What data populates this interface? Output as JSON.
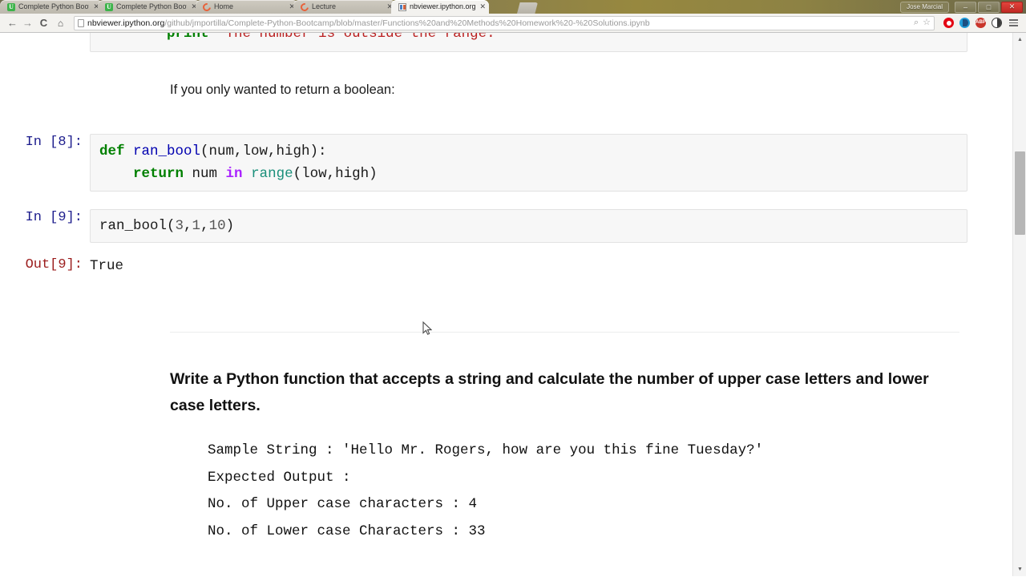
{
  "window": {
    "user_label": "Jose Marcial",
    "minimize_label": "–",
    "maximize_label": "□",
    "close_label": "✕"
  },
  "tabs": [
    {
      "title": "Complete Python Bootcar",
      "favicon": "udemy-icon",
      "close_label": "✕",
      "active": false
    },
    {
      "title": "Complete Python Bootcar",
      "favicon": "udemy-icon",
      "close_label": "✕",
      "active": false
    },
    {
      "title": "Home",
      "favicon": "jupyter-icon",
      "close_label": "✕",
      "active": false
    },
    {
      "title": "Lecture",
      "favicon": "jupyter-icon",
      "close_label": "✕",
      "active": false
    },
    {
      "title": "nbviewer.ipython.org/gith",
      "favicon": "nbviewer-icon",
      "close_label": "✕",
      "active": true
    }
  ],
  "toolbar": {
    "back_label": "←",
    "forward_label": "→",
    "reload_label": "C",
    "home_label": "⌂",
    "url_host": "nbviewer.ipython.org",
    "url_path": "/github/jmportilla/Complete-Python-Bootcamp/blob/master/Functions%20and%20Methods%20Homework%20-%20Solutions.ipynb",
    "url_full": "nbviewer.ipython.org/github/jmportilla/Complete-Python-Bootcamp/blob/master/Functions%20and%20Methods%20Homework%20-%20Solutions.ipynb",
    "search_icon_label": "⌕",
    "bookmark_icon_label": "☆",
    "ext_abp_label": "ABP"
  },
  "notebook": {
    "top_cell": {
      "indent": "        ",
      "keyword": "print",
      "space": " ",
      "string": "\"The number is outside the range.\""
    },
    "markdown_intro": "If you only wanted to return a boolean:",
    "cell_in8": {
      "prompt": "In [8]:",
      "line1_def": "def",
      "line1_name": " ran_bool",
      "line1_args": "(num,low,high):",
      "line2_indent": "    ",
      "line2_return": "return",
      "line2_mid": " num ",
      "line2_in": "in",
      "line2_range": " range",
      "line2_args": "(low,high)"
    },
    "cell_in9": {
      "prompt": "In [9]:",
      "call_name": "ran_bool(",
      "arg1": "3",
      "comma1": ",",
      "arg2": "1",
      "comma2": ",",
      "arg3": "10",
      "close": ")"
    },
    "cell_out9": {
      "prompt": "Out[9]:",
      "value": "True"
    },
    "question_heading": "Write a Python function that accepts a string and calculate the number of upper case letters and lower case letters.",
    "sample_block": {
      "line1": "Sample String : 'Hello Mr. Rogers, how are you this fine Tuesday?'",
      "line2": "Expected Output :",
      "line3": "No. of Upper case characters : 4",
      "line4": "No. of Lower case Characters : 33"
    }
  },
  "scrollbar": {
    "up_arrow": "▲",
    "down_arrow": "▼"
  },
  "colors": {
    "keyword_green": "#008000",
    "string_red": "#ba2121",
    "prompt_blue": "#1c1c8c",
    "prompt_red": "#9b1c1c",
    "operator_purple": "#aa22ff",
    "builtin_teal": "#1a8f7a",
    "cell_bg": "#f7f7f7"
  }
}
